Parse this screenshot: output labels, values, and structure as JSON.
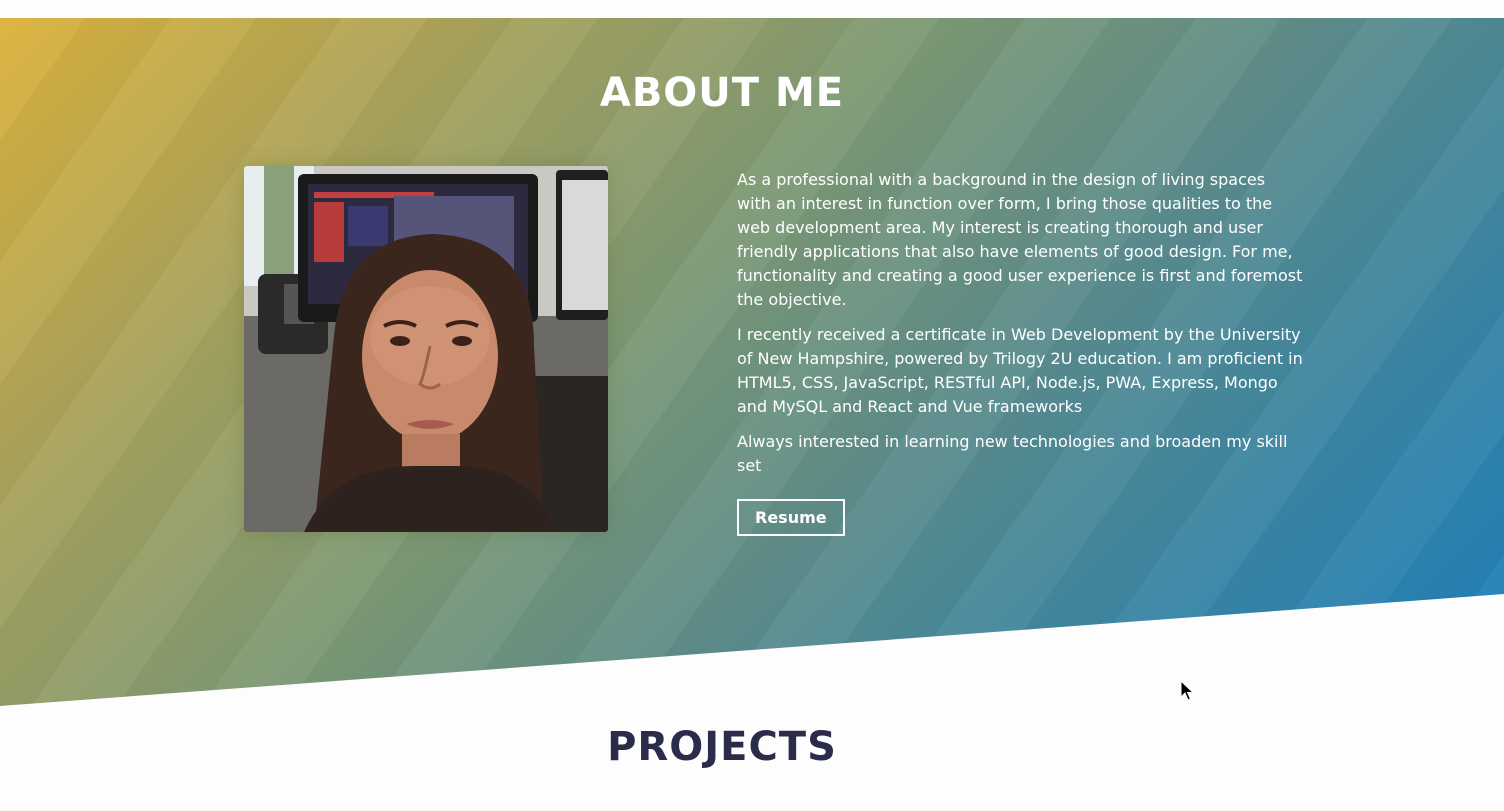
{
  "about": {
    "title": "ABOUT ME",
    "paragraphs": [
      "As a professional with a background in the design of living spaces with an interest in function over form, I bring those qualities to the web development area. My interest is creating thorough and user friendly applications that also have elements of good design. For me, functionality and creating a good user experience is first and foremost the objective.",
      "I recently received a certificate in Web Development by the University of New Hampshire, powered by Trilogy 2U education. I am proficient in HTML5, CSS, JavaScript, RESTful API, Node.js, PWA, Express, Mongo and MySQL and React and Vue frameworks",
      "Always interested in learning new technologies and broaden my skill set"
    ],
    "resume_label": "Resume",
    "photo_icon": "profile-photo"
  },
  "projects": {
    "title": "PROJECTS"
  },
  "colors": {
    "gradient_start": "#dcb23c",
    "gradient_end": "#1d7fbd",
    "heading_dark": "#2b2b4a",
    "text_light": "#ffffff"
  }
}
